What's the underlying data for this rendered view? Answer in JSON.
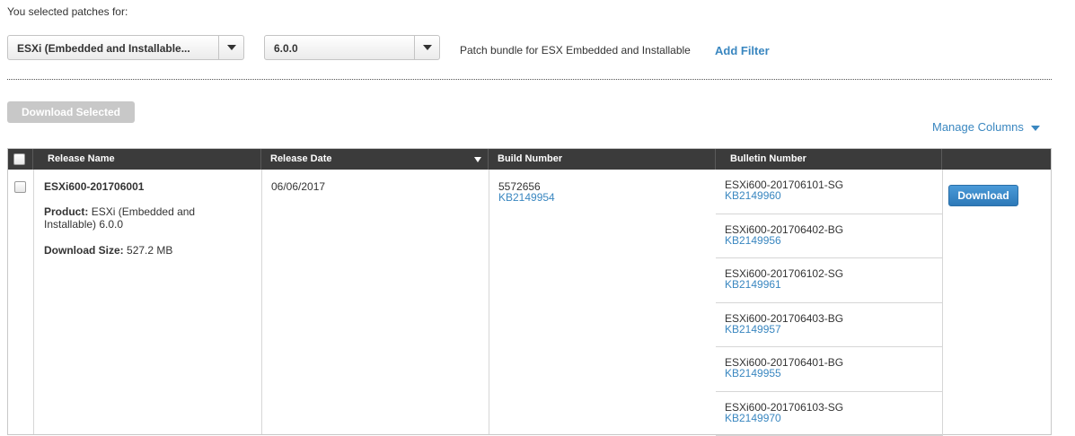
{
  "header": {
    "intro": "You selected patches for:",
    "product_select": {
      "value": "ESXi (Embedded and Installable..."
    },
    "version_select": {
      "value": "6.0.0"
    },
    "bundle_description": "Patch bundle for ESX Embedded and Installable",
    "add_filter_label": "Add Filter"
  },
  "toolbar": {
    "download_selected_label": "Download Selected",
    "manage_columns_label": "Manage Columns"
  },
  "table": {
    "columns": [
      "Release Name",
      "Release Date",
      "Build Number",
      "Bulletin Number"
    ],
    "row": {
      "release_name": "ESXi600-201706001",
      "product_label": "Product:",
      "product_value": "ESXi (Embedded and Installable) 6.0.0",
      "size_label": "Download Size:",
      "size_value": "527.2 MB",
      "release_date": "06/06/2017",
      "build_number": "5572656",
      "build_kb": "KB2149954",
      "bulletins": [
        {
          "name": "ESXi600-201706101-SG",
          "kb": "KB2149960"
        },
        {
          "name": "ESXi600-201706402-BG",
          "kb": "KB2149956"
        },
        {
          "name": "ESXi600-201706102-SG",
          "kb": "KB2149961"
        },
        {
          "name": "ESXi600-201706403-BG",
          "kb": "KB2149957"
        },
        {
          "name": "ESXi600-201706401-BG",
          "kb": "KB2149955"
        },
        {
          "name": "ESXi600-201706103-SG",
          "kb": "KB2149970"
        }
      ],
      "download_label": "Download"
    }
  },
  "colors": {
    "link": "#3a87c0",
    "header_bg": "#3b3b3b",
    "primary_button": "#3a87c0",
    "disabled_button": "#c8c8c8"
  }
}
